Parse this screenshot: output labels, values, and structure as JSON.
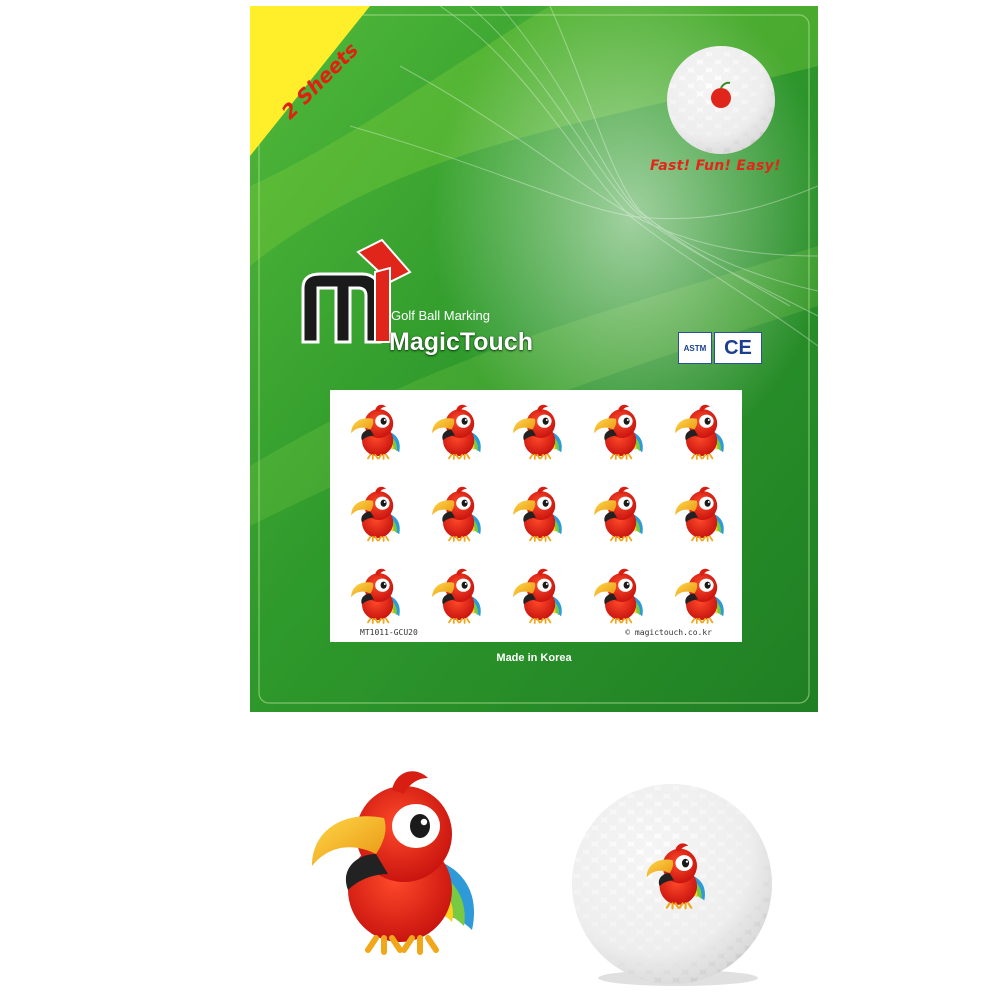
{
  "package": {
    "ribbon_text": "2 Sheets",
    "tagline": "Fast! Fun! Easy!",
    "brand_subtitle": "Golf Ball Marking",
    "brand_name": "MagicTouch",
    "cert_marks": [
      "ASTM",
      "CE"
    ],
    "sheet_code": "MT1011-GCU20",
    "sheet_website": "© magictouch.co.kr",
    "made_in": "Made in Korea",
    "sticker_rows": 3,
    "sticker_cols": 5,
    "sticker_design": "parrot"
  },
  "colors": {
    "package_green": "#2f9a2c",
    "package_light_green": "#7fcf3a",
    "ribbon_yellow": "#ffee2a",
    "accent_red": "#e32619",
    "parrot_red": "#e0251b",
    "beak_yellow": "#f7b21c"
  },
  "icons": [
    "apple-icon",
    "parrot-icon",
    "golf-ball-icon",
    "magictouch-logo-icon",
    "ce-mark-icon",
    "astm-mark-icon"
  ]
}
